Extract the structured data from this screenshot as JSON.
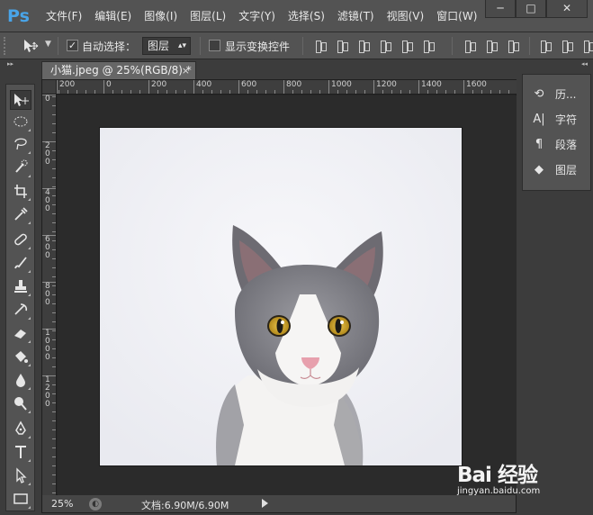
{
  "app": {
    "logo": "Ps",
    "menu": [
      "文件(F)",
      "编辑(E)",
      "图像(I)",
      "图层(L)",
      "文字(Y)",
      "选择(S)",
      "滤镜(T)",
      "视图(V)",
      "窗口(W)"
    ],
    "window_controls": {
      "minimize": "─",
      "maximize": "□",
      "close": "✕"
    }
  },
  "options_bar": {
    "auto_select_label": "自动选择：",
    "auto_select_checked": "✓",
    "layer_select_value": "图层",
    "show_transform_label": "显示变换控件"
  },
  "collapse_arrows": {
    "left": "▸▸",
    "right": "◂◂"
  },
  "document": {
    "tab_title": "小猫.jpeg @ 25%(RGB/8) *",
    "tab_close": "×",
    "ruler_h": [
      "200",
      "0",
      "200",
      "400",
      "600",
      "800",
      "1000",
      "1200",
      "1400",
      "1600"
    ],
    "ruler_v": [
      "0",
      "2\n0\n0",
      "4\n0\n0",
      "6\n0\n0",
      "8\n0\n0",
      "1\n0\n0\n0",
      "1\n2\n0\n0"
    ]
  },
  "status": {
    "zoom": "25%",
    "doc_size": "文档:6.90M/6.90M"
  },
  "panels": [
    {
      "icon": "history-icon",
      "label": "历..."
    },
    {
      "icon": "character-icon",
      "label": "字符"
    },
    {
      "icon": "paragraph-icon",
      "label": "段落"
    },
    {
      "icon": "layers-icon",
      "label": "图层"
    }
  ],
  "watermark": {
    "logo": "Bai 经验",
    "url": "jingyan.baidu.com"
  },
  "colors": {
    "ui_dark": "#535353",
    "canvas_bg": "#282828",
    "accent_ps": "#49a4e8"
  }
}
